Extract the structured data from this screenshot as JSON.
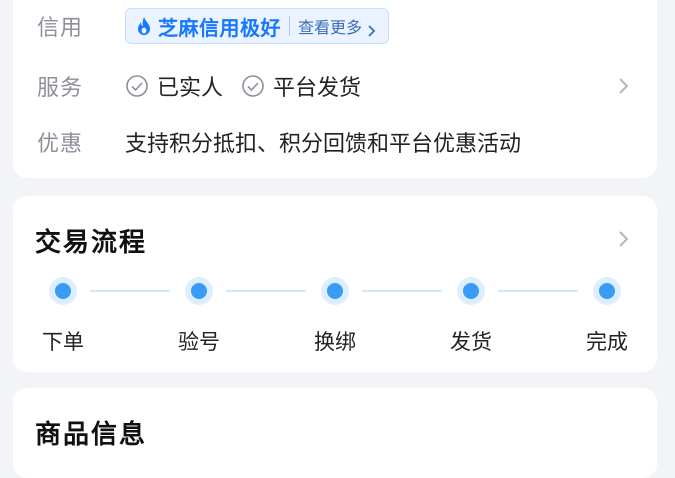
{
  "info": {
    "credit": {
      "label": "信用",
      "badge_text": "芝麻信用极好",
      "more_text": "查看更多"
    },
    "service": {
      "label": "服务",
      "items": [
        "已实人",
        "平台发货"
      ]
    },
    "discount": {
      "label": "优惠",
      "text": "支持积分抵扣、积分回馈和平台优惠活动"
    }
  },
  "process": {
    "title": "交易流程",
    "steps": [
      "下单",
      "验号",
      "换绑",
      "发货",
      "完成"
    ],
    "accent_color": "#3a9bf5"
  },
  "goods": {
    "title": "商品信息"
  }
}
